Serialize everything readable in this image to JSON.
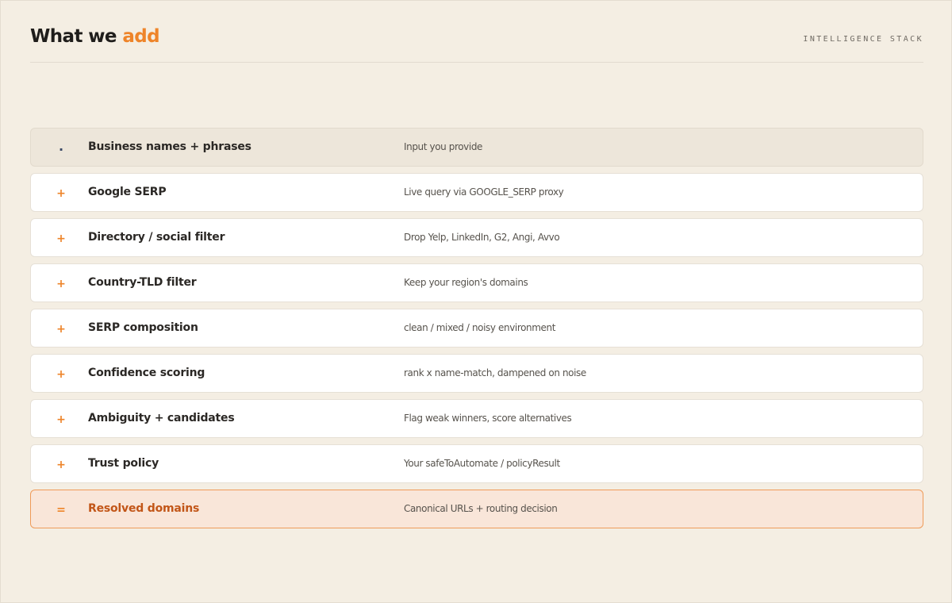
{
  "header": {
    "title_main": "What we ",
    "title_accent": "add",
    "kicker": "INTELLIGENCE STACK"
  },
  "colors": {
    "accent": "#ee8429",
    "background": "#f4eee3",
    "result_text": "#c25618",
    "result_border": "#ef9b59"
  },
  "rows": [
    {
      "kind": "input",
      "marker": ".",
      "label": "Business names + phrases",
      "desc": "Input you provide"
    },
    {
      "kind": "step",
      "marker": "+",
      "label": "Google SERP",
      "desc": "Live query via GOOGLE_SERP proxy"
    },
    {
      "kind": "step",
      "marker": "+",
      "label": "Directory / social filter",
      "desc": "Drop Yelp, LinkedIn, G2, Angi, Avvo"
    },
    {
      "kind": "step",
      "marker": "+",
      "label": "Country-TLD filter",
      "desc": "Keep your region's domains"
    },
    {
      "kind": "step",
      "marker": "+",
      "label": "SERP composition",
      "desc": "clean / mixed / noisy environment"
    },
    {
      "kind": "step",
      "marker": "+",
      "label": "Confidence scoring",
      "desc": "rank x name-match, dampened on noise"
    },
    {
      "kind": "step",
      "marker": "+",
      "label": "Ambiguity + candidates",
      "desc": "Flag weak winners, score alternatives"
    },
    {
      "kind": "step",
      "marker": "+",
      "label": "Trust policy",
      "desc": "Your safeToAutomate / policyResult"
    },
    {
      "kind": "result",
      "marker": "=",
      "label": "Resolved domains",
      "desc": "Canonical URLs + routing decision"
    }
  ]
}
